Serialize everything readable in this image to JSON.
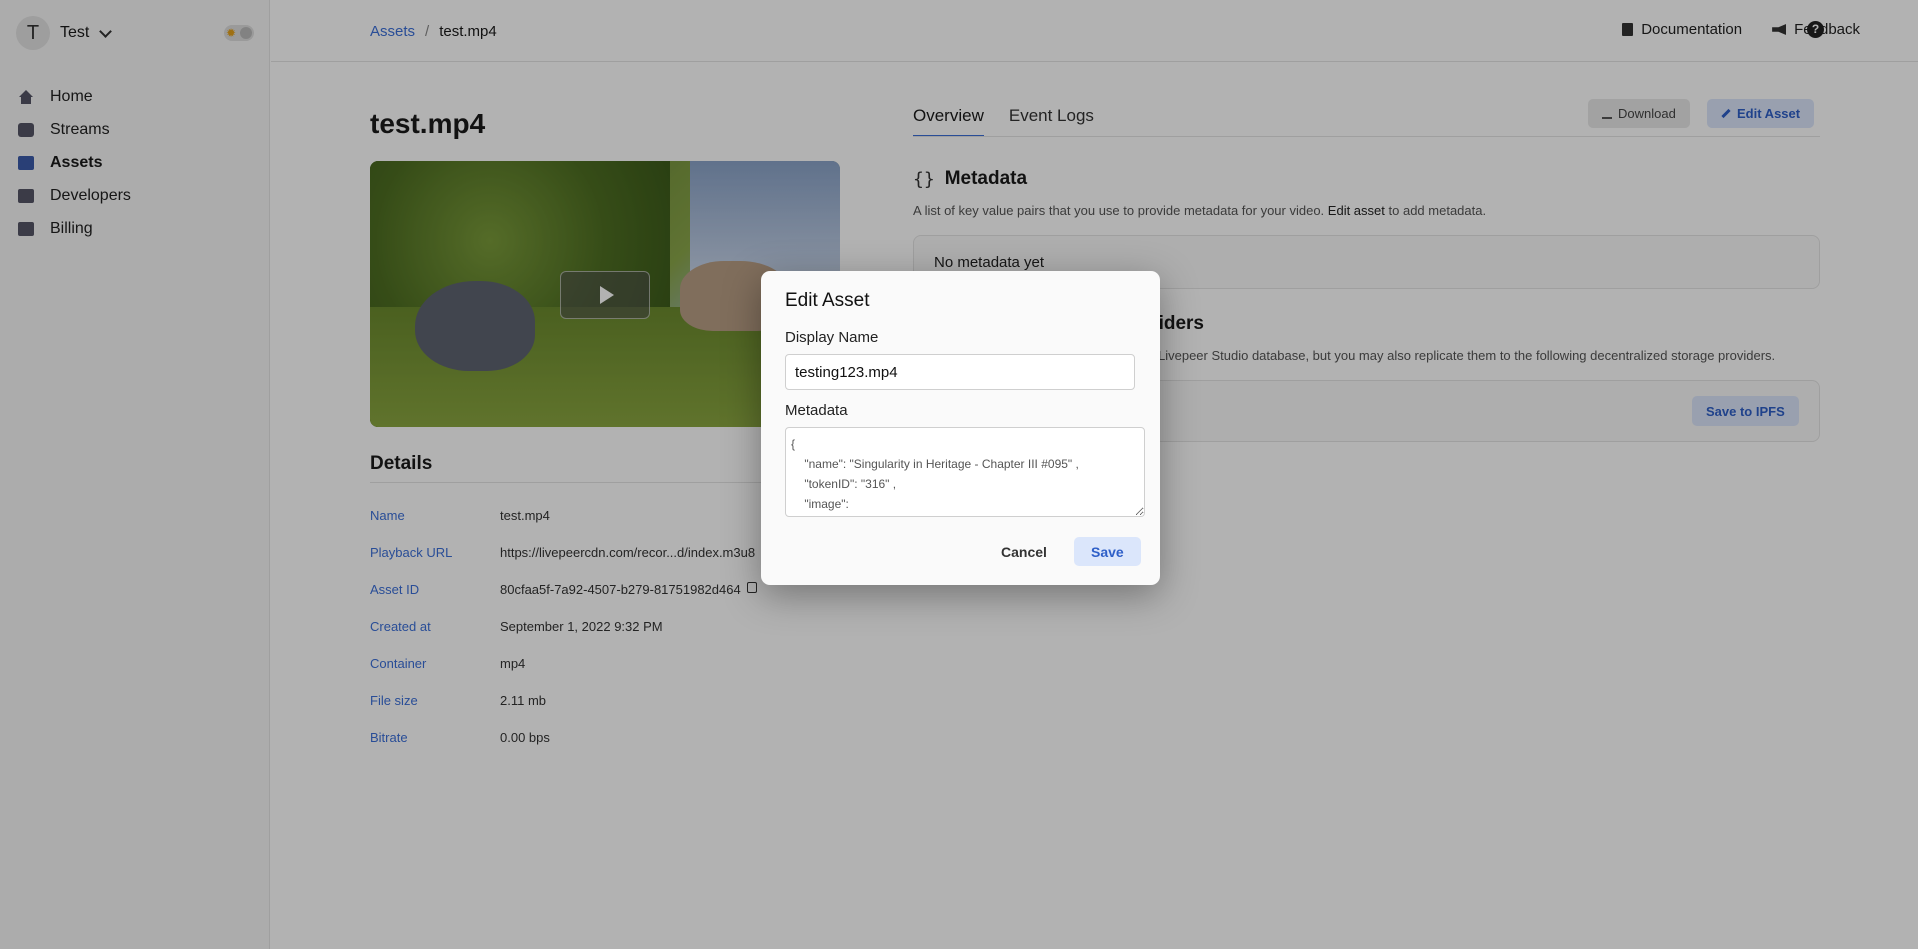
{
  "workspace": {
    "initial": "T",
    "name": "Test"
  },
  "sidebar": {
    "items": [
      {
        "label": "Home",
        "icon": "home-icon"
      },
      {
        "label": "Streams",
        "icon": "streams-icon"
      },
      {
        "label": "Assets",
        "icon": "assets-icon",
        "active": true
      },
      {
        "label": "Developers",
        "icon": "developers-icon"
      },
      {
        "label": "Billing",
        "icon": "billing-icon"
      }
    ]
  },
  "breadcrumb": {
    "root": "Assets",
    "separator": "/",
    "current": "test.mp4"
  },
  "header": {
    "documentation": "Documentation",
    "feedback": "Feedback",
    "help": "?"
  },
  "asset": {
    "title": "test.mp4",
    "details_title": "Details",
    "details": [
      {
        "key": "Name",
        "value": "test.mp4"
      },
      {
        "key": "Playback URL",
        "value": "https://livepeercdn.com/recor...d/index.m3u8"
      },
      {
        "key": "Asset ID",
        "value": "80cfaa5f-7a92-4507-b279-81751982d464"
      },
      {
        "key": "Created at",
        "value": "September 1, 2022 9:32 PM"
      },
      {
        "key": "Container",
        "value": "mp4"
      },
      {
        "key": "File size",
        "value": "2.11 mb"
      },
      {
        "key": "Bitrate",
        "value": "0.00 bps"
      }
    ]
  },
  "tabs": [
    {
      "label": "Overview",
      "active": true
    },
    {
      "label": "Event Logs"
    }
  ],
  "actions": {
    "download": "Download",
    "edit": "Edit Asset"
  },
  "metadata": {
    "title": "Metadata",
    "desc_prefix": "A list of key value pairs that you use to provide metadata for your video.",
    "desc_link": "Edit asset",
    "desc_suffix": "to add metadata.",
    "empty": "No metadata yet"
  },
  "storage": {
    "title_visible": "viders",
    "desc_visible": "Livepeer Studio database, but you may also replicate them to the following decentralized storage providers.",
    "save_ipfs": "Save to IPFS"
  },
  "modal": {
    "title": "Edit Asset",
    "display_name_label": "Display Name",
    "display_name_value": "testing123.mp4",
    "metadata_label": "Metadata",
    "metadata_value": "{\n    \"name\": \"Singularity in Heritage - Chapter III #095\" ,\n    \"tokenID\": \"316\" ,\n    \"image\":",
    "cancel": "Cancel",
    "save": "Save"
  },
  "colors": {
    "accent": "#3b6fd8",
    "accent_bg": "#dbe6fb",
    "overlay": "rgba(0,0,0,0.30)"
  }
}
